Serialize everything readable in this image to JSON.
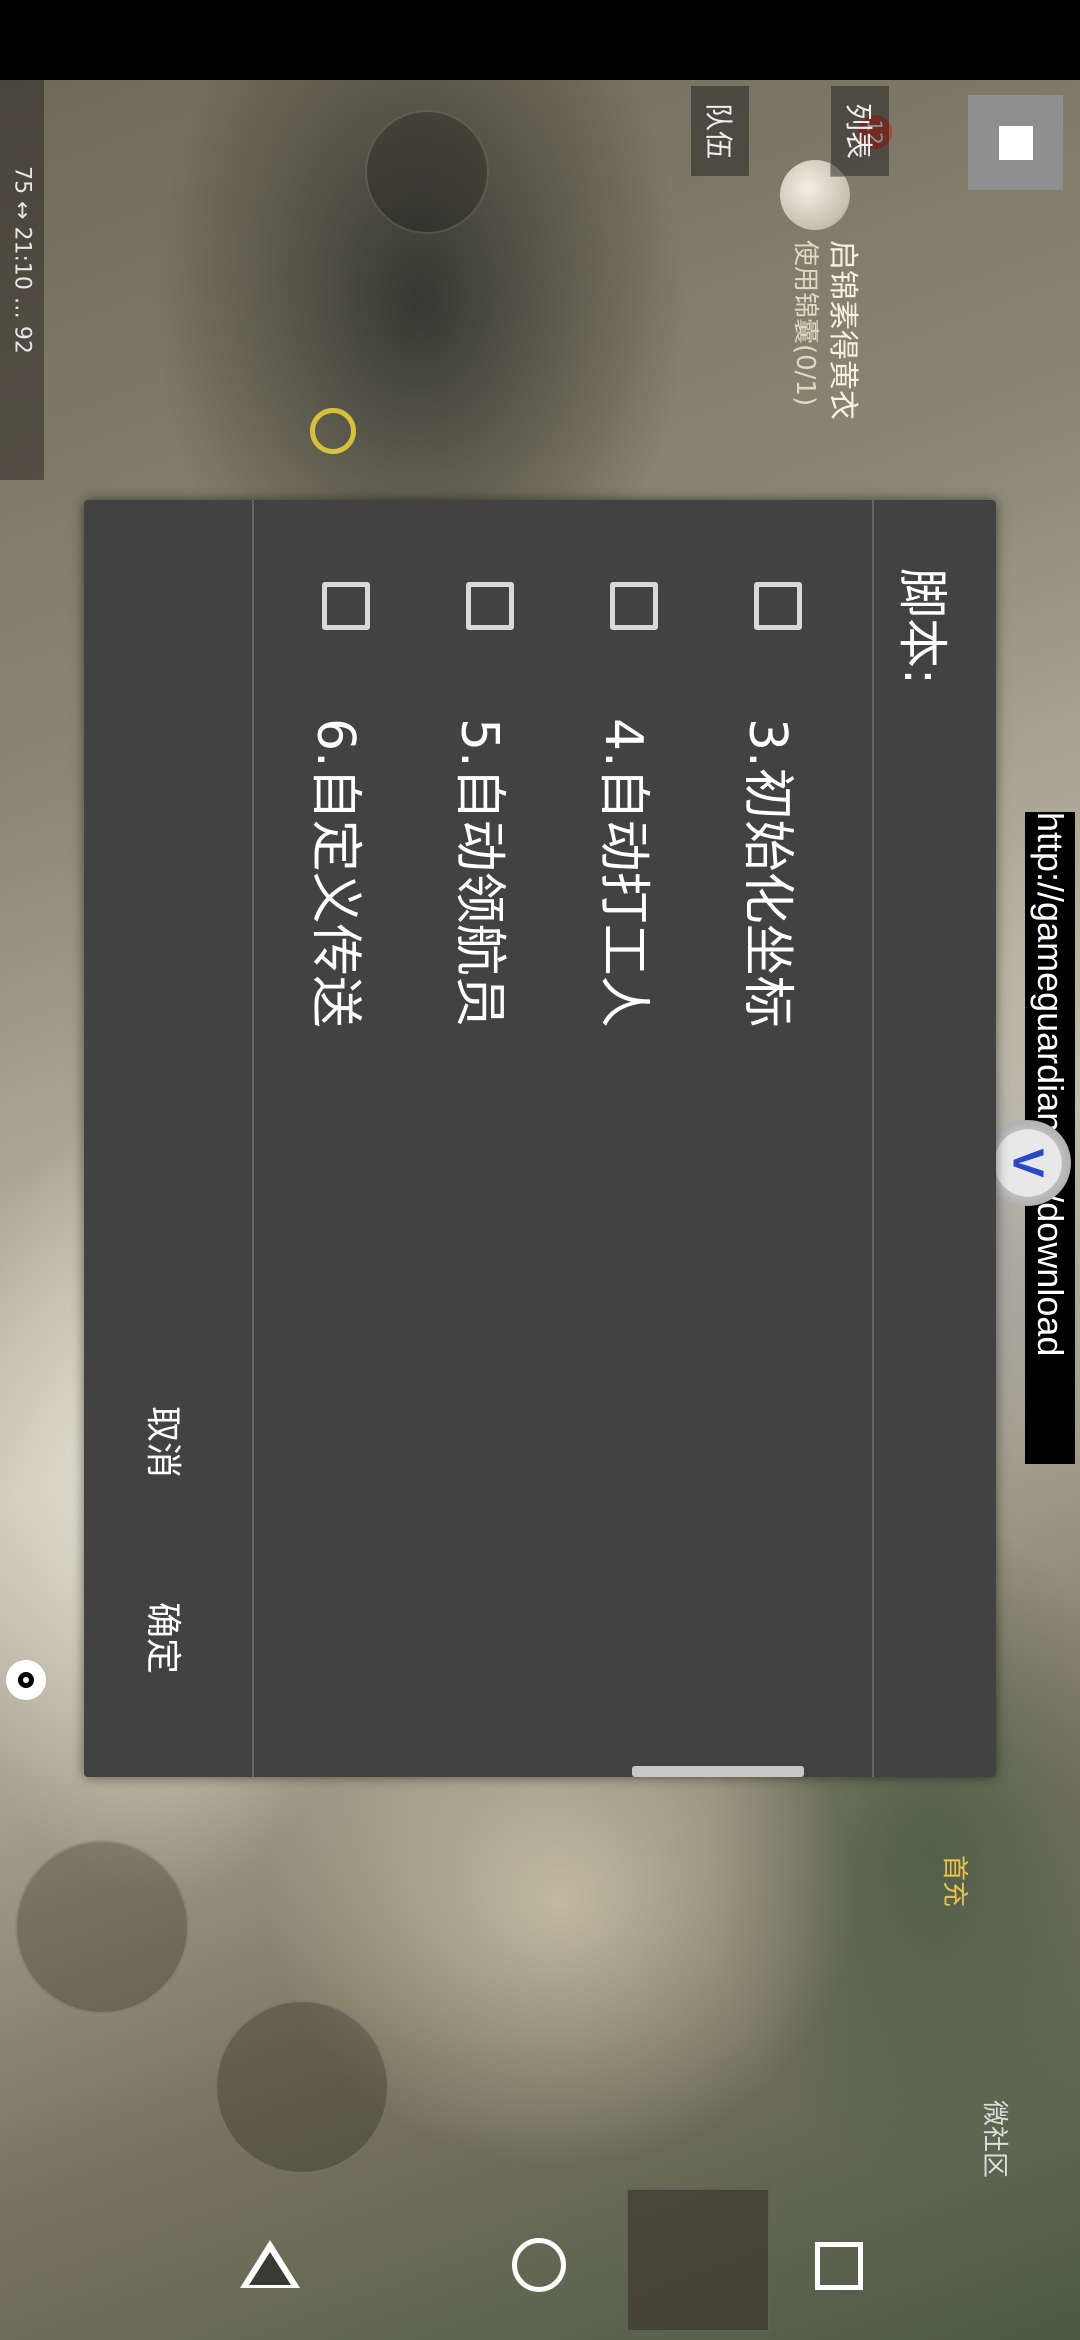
{
  "status_bar": {
    "text": "75 ↔ 21:10 … 92"
  },
  "game_hud": {
    "quest_title": "启锦素得黄衣",
    "quest_sub": "使用锦囊(0/1)",
    "badge_count": "12",
    "tab_list": "列表",
    "tab_team": "队伍",
    "shop_label": "首充",
    "community_label": "微社区"
  },
  "overlay": {
    "url_banner": "http://gameguardian.net/download",
    "gg_icon": "V"
  },
  "dialog": {
    "title": "脚本:",
    "options": [
      {
        "label": "3.初始化坐标",
        "checked": false
      },
      {
        "label": "4.自动打工人",
        "checked": false
      },
      {
        "label": "5.自动领航员",
        "checked": false
      },
      {
        "label": "6.自定义传送",
        "checked": false
      }
    ],
    "cancel_label": "取消",
    "ok_label": "确定"
  },
  "icons": {
    "stop": "stop-square-icon",
    "eye": "eye-icon",
    "nav_back": "triangle-back-icon",
    "nav_home": "circle-home-icon",
    "nav_recent": "square-recent-icon"
  }
}
